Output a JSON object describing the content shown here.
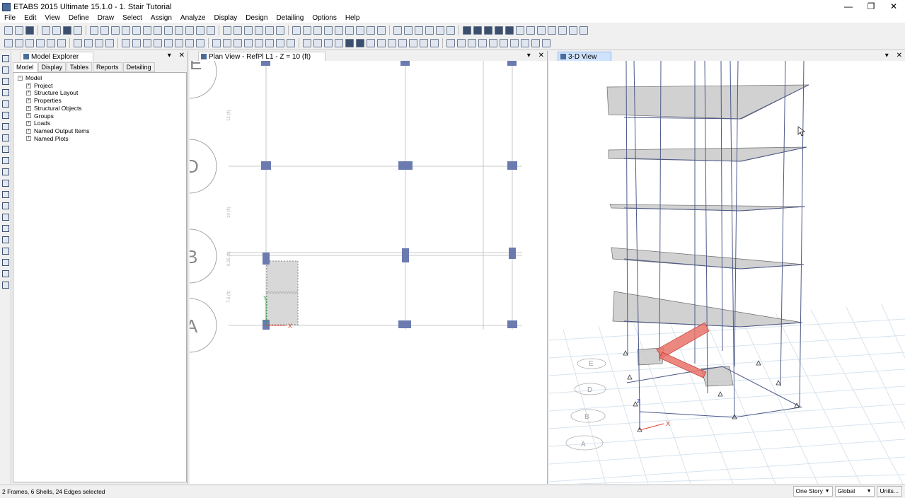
{
  "window": {
    "title": "ETABS 2015 Ultimate 15.1.0 - 1. Stair Tutorial",
    "minimize_glyph": "—",
    "restore_glyph": "❐",
    "close_glyph": "✕"
  },
  "menu": [
    "File",
    "Edit",
    "View",
    "Define",
    "Draw",
    "Select",
    "Assign",
    "Analyze",
    "Display",
    "Design",
    "Detailing",
    "Options",
    "Help"
  ],
  "explorer": {
    "title": "Model Explorer",
    "pin_glyph": "▾",
    "close_glyph": "✕",
    "tabs": [
      "Model",
      "Display",
      "Tables",
      "Reports",
      "Detailing"
    ],
    "root": "Model",
    "items": [
      "Project",
      "Structure Layout",
      "Properties",
      "Structural Objects",
      "Groups",
      "Loads",
      "Named Output Items",
      "Named Plots"
    ]
  },
  "plan_view": {
    "title": "Plan View - RefPl L1 - Z = 10 (ft)",
    "grid_bubbles": [
      "E",
      "D",
      "B",
      "A"
    ],
    "dims": [
      "12 (ft)",
      "10 (ft)",
      "0.25 (ft)",
      "7.5 (ft)"
    ],
    "axis_x": "X",
    "axis_y": "Y"
  },
  "view_3d": {
    "title": "3-D View",
    "axis_x": "X",
    "axis_z": "Z",
    "grid_bubbles": [
      "E",
      "D",
      "B",
      "A"
    ]
  },
  "status": {
    "text": "2 Frames, 6 Shells, 24 Edges selected",
    "story": "One Story",
    "coord": "Global",
    "units": "Units..."
  },
  "colors": {
    "frame": "#4d5a8a",
    "column": "#6b7bb0",
    "slab": "#c6c6c6",
    "stair": "#e8736a",
    "grid": "#d7e3ee"
  }
}
